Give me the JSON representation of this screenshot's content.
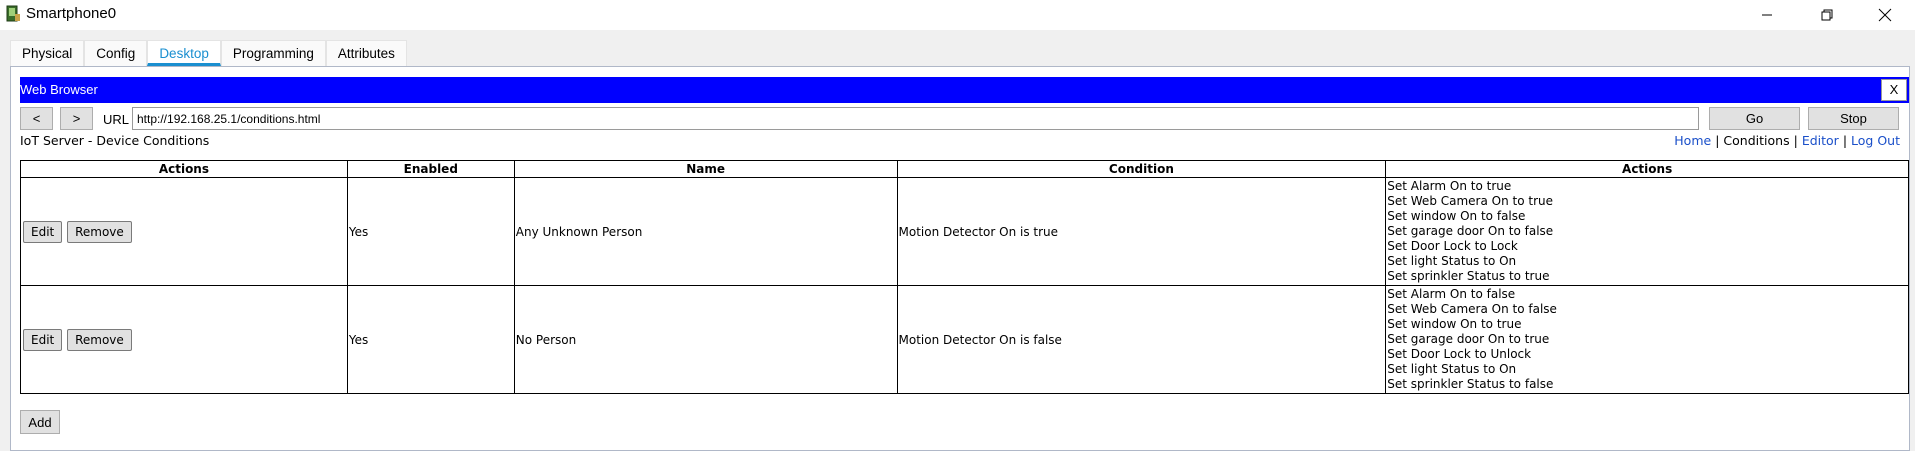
{
  "window": {
    "title": "Smartphone0"
  },
  "tabs": [
    "Physical",
    "Config",
    "Desktop",
    "Programming",
    "Attributes"
  ],
  "browser": {
    "header_title": "Web Browser",
    "close_label": "X",
    "back_label": "<",
    "forward_label": ">",
    "url_label": "URL",
    "url_value": "http://192.168.25.1/conditions.html",
    "go_label": "Go",
    "stop_label": "Stop"
  },
  "page": {
    "title": "IoT Server - Device Conditions",
    "links": [
      "Home",
      "Conditions",
      "Editor",
      "Log Out"
    ],
    "add_label": "Add"
  },
  "table": {
    "headers": [
      "Actions",
      "Enabled",
      "Name",
      "Condition",
      "Actions"
    ],
    "edit_label": "Edit",
    "remove_label": "Remove",
    "rows": [
      {
        "enabled": "Yes",
        "name": "Any Unknown Person",
        "condition": "Motion Detector On is true",
        "actions": [
          "Set Alarm On to true",
          "Set Web Camera On to true",
          "Set window On to false",
          "Set garage door On to false",
          "Set Door Lock to Lock",
          "Set light Status to On",
          "Set sprinkler Status to true"
        ]
      },
      {
        "enabled": "Yes",
        "name": "No Person",
        "condition": "Motion Detector On is false",
        "actions": [
          "Set Alarm On to false",
          "Set Web Camera On to false",
          "Set window On to true",
          "Set garage door On to true",
          "Set Door Lock to Unlock",
          "Set light Status to On",
          "Set sprinkler Status to false"
        ]
      }
    ]
  }
}
